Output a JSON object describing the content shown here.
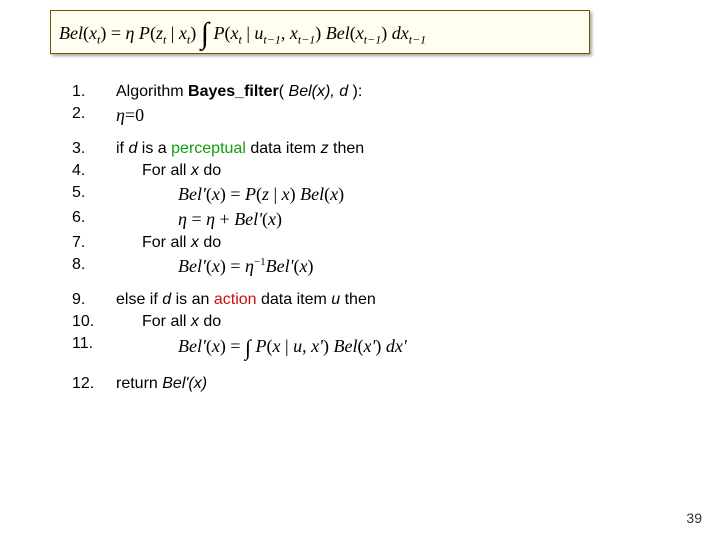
{
  "header_equation": {
    "lhs": "Bel(x_t)",
    "rhs_html": "η P(z_t | x_t) ∫ P(x_t | u_{t-1}, x_{t-1}) Bel(x_{t-1}) dx_{t-1}"
  },
  "lines": {
    "n1": "1.",
    "t1a": "Algorithm ",
    "t1b": "Bayes_filter",
    "t1c": "( ",
    "t1d": "Bel(x), d",
    "t1e": " ):",
    "n2": "2.",
    "t2": "η=0",
    "n3": "3.",
    "t3a": "if ",
    "t3b": "d",
    "t3c": " is a ",
    "t3d": "perceptual",
    "t3e": " data item ",
    "t3f": "z",
    "t3g": " then",
    "n4": "4.",
    "t4": "For all ",
    "t4x": "x",
    "t4do": " do",
    "n5": "5.",
    "eq5": "Bel'(x) = P(z | x) Bel(x)",
    "n6": "6.",
    "eq6": "η = η + Bel'(x)",
    "n7": "7.",
    "t7": "For all ",
    "t7x": "x",
    "t7do": " do",
    "n8": "8.",
    "eq8": "Bel'(x) = η⁻¹ Bel'(x)",
    "n9": "9.",
    "t9a": "else if ",
    "t9b": "d",
    "t9c": " is an ",
    "t9d": "action",
    "t9e": " data item ",
    "t9f": "u",
    "t9g": " then",
    "n10": "10.",
    "t10": "For all ",
    "t10x": "x",
    "t10do": " do",
    "n11": "11.",
    "eq11": "Bel'(x) = ∫ P(x | u, x') Bel(x') dx'",
    "n12": "12.",
    "t12a": "return ",
    "t12b": "Bel'(x)"
  },
  "page_number": "39"
}
